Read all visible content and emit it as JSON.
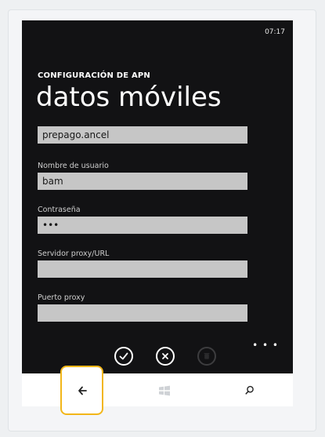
{
  "status": {
    "time": "07:17"
  },
  "header": {
    "app_title": "CONFIGURACIÓN DE APN",
    "page_title": "datos móviles"
  },
  "form": {
    "apn_value": "prepago.ancel",
    "username": {
      "label": "Nombre de usuario",
      "value": "bam"
    },
    "password": {
      "label": "Contraseña",
      "value": "•••"
    },
    "proxy_server": {
      "label": "Servidor proxy/URL",
      "value": ""
    },
    "proxy_port": {
      "label": "Puerto proxy",
      "value": ""
    }
  },
  "app_bar": {
    "buttons": [
      {
        "icon": "check-icon",
        "enabled": true
      },
      {
        "icon": "cancel-icon",
        "enabled": true
      },
      {
        "icon": "delete-icon",
        "enabled": false
      }
    ],
    "more_icon": "more-dots-icon"
  },
  "nav_bar": {
    "icons": [
      "back-arrow-icon",
      "windows-logo-icon",
      "search-icon"
    ],
    "highlight_color": "#f2b619"
  }
}
